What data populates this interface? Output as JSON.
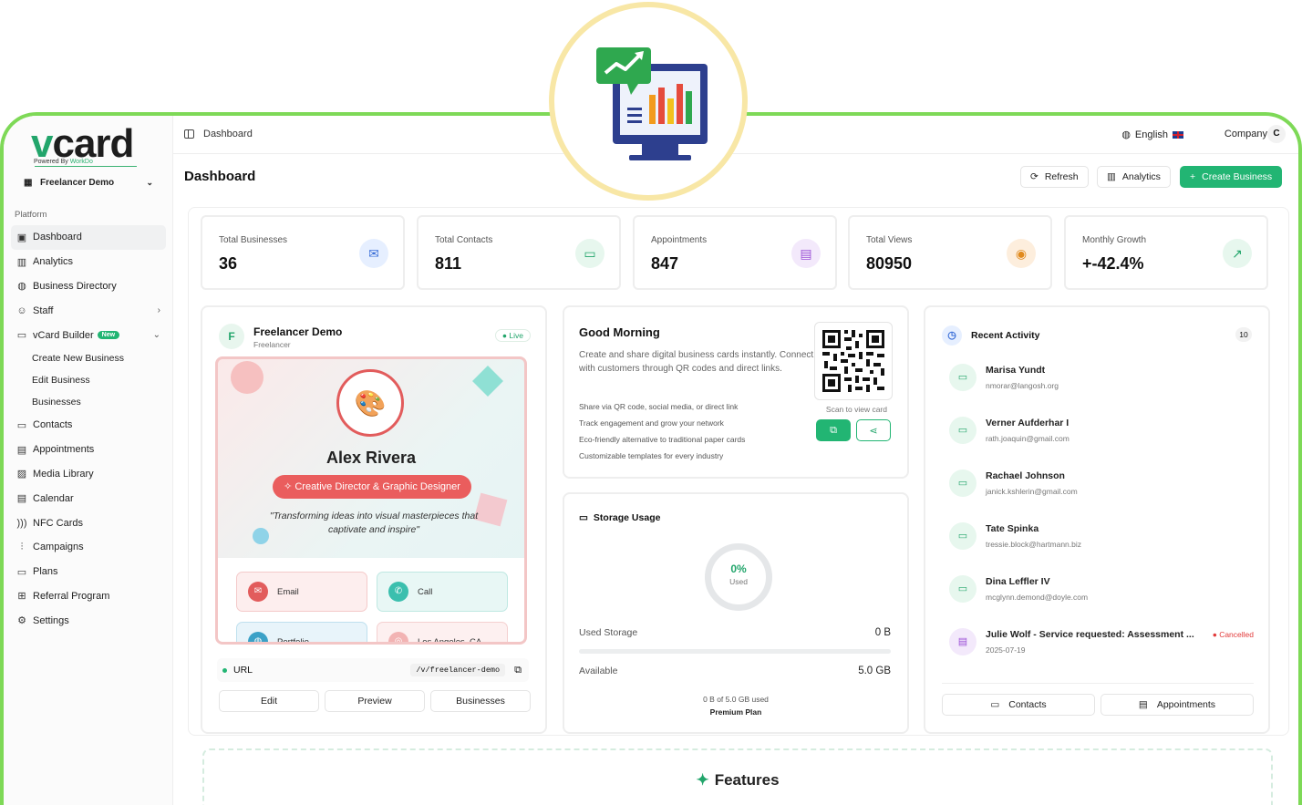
{
  "brand": {
    "logo_v": "v",
    "logo_rest": "card",
    "powered_by_prefix": "Powered By",
    "powered_by_name": "WorkDo"
  },
  "workspace": {
    "name": "Freelancer Demo"
  },
  "sidebar": {
    "heading": "Platform",
    "items": [
      {
        "label": "Dashboard",
        "icon": "grid-icon"
      },
      {
        "label": "Analytics",
        "icon": "bar-chart-icon"
      },
      {
        "label": "Business Directory",
        "icon": "globe-icon"
      },
      {
        "label": "Staff",
        "icon": "users-icon"
      },
      {
        "label": "vCard Builder",
        "icon": "message-square-icon",
        "badge": "New"
      },
      {
        "label": "Create New Business"
      },
      {
        "label": "Edit Business"
      },
      {
        "label": "Businesses"
      },
      {
        "label": "Contacts",
        "icon": "chat-icon"
      },
      {
        "label": "Appointments",
        "icon": "calendar-icon"
      },
      {
        "label": "Media Library",
        "icon": "image-icon"
      },
      {
        "label": "Calendar",
        "icon": "calendar-icon"
      },
      {
        "label": "NFC Cards",
        "icon": "nfc-icon"
      },
      {
        "label": "Campaigns",
        "icon": "signal-icon"
      },
      {
        "label": "Plans",
        "icon": "card-icon"
      },
      {
        "label": "Referral Program",
        "icon": "gift-icon"
      },
      {
        "label": "Settings",
        "icon": "gear-icon"
      }
    ]
  },
  "topbar": {
    "breadcrumb": "Dashboard",
    "language": "English",
    "company": "Company",
    "avatar_initial": "C"
  },
  "header": {
    "title": "Dashboard",
    "refresh": "Refresh",
    "analytics": "Analytics",
    "create": "Create Business"
  },
  "stats": [
    {
      "label": "Total Businesses",
      "value": "36",
      "icon": "mail-icon",
      "color": "#3b6fd8",
      "bg": "#e6efff"
    },
    {
      "label": "Total Contacts",
      "value": "811",
      "icon": "chat-icon",
      "color": "#22a56b",
      "bg": "#e7f7ee"
    },
    {
      "label": "Appointments",
      "value": "847",
      "icon": "calendar-icon",
      "color": "#9b4fd6",
      "bg": "#f3e9fb"
    },
    {
      "label": "Total Views",
      "value": "80950",
      "icon": "eye-icon",
      "color": "#e08a1e",
      "bg": "#fdeedd"
    },
    {
      "label": "Monthly Growth",
      "value": "+-42.4%",
      "icon": "trending-up-icon",
      "color": "#22a56b",
      "bg": "#e7f7ee"
    }
  ],
  "profile": {
    "initial": "F",
    "name": "Freelancer Demo",
    "role": "Freelancer",
    "status": "Live",
    "preview_name": "Alex Rivera",
    "preview_role": "Creative Director & Graphic Designer",
    "preview_quote": "\"Transforming ideas into visual masterpieces that captivate and inspire\"",
    "actions": [
      "Email",
      "Call",
      "Portfolio",
      "Los Angeles, CA"
    ],
    "url_label": "URL",
    "url_path": "/v/freelancer-demo",
    "buttons": [
      "Edit",
      "Preview",
      "Businesses"
    ]
  },
  "greeting": {
    "title": "Good Morning",
    "description": "Create and share digital business cards instantly. Connect with customers through QR codes and direct links.",
    "bullets": [
      "Share via QR code, social media, or direct link",
      "Track engagement and grow your network",
      "Eco-friendly alternative to traditional paper cards",
      "Customizable templates for every industry"
    ],
    "scan": "Scan to view card"
  },
  "storage": {
    "title": "Storage Usage",
    "percent": "0%",
    "used_label": "Used",
    "used_storage_label": "Used Storage",
    "used_storage_value": "0 B",
    "usage_fraction": 0,
    "available_label": "Available",
    "available_value": "5.0 GB",
    "summary": "0 B of 5.0 GB used",
    "plan": "Premium Plan"
  },
  "activity": {
    "title": "Recent Activity",
    "count": "10",
    "items": [
      {
        "name": "Marisa Yundt",
        "detail": "nmorar@langosh.org",
        "icon": "chat-icon"
      },
      {
        "name": "Verner Aufderhar I",
        "detail": "rath.joaquin@gmail.com",
        "icon": "chat-icon"
      },
      {
        "name": "Rachael Johnson",
        "detail": "janick.kshlerin@gmail.com",
        "icon": "chat-icon"
      },
      {
        "name": "Tate Spinka",
        "detail": "tressie.block@hartmann.biz",
        "icon": "chat-icon"
      },
      {
        "name": "Dina Leffler IV",
        "detail": "mcglynn.demond@doyle.com",
        "icon": "chat-icon"
      },
      {
        "name": "Julie Wolf - Service requested: Assessment ...",
        "detail": "2025-07-19",
        "icon": "calendar-icon",
        "status": "Cancelled"
      }
    ],
    "buttons": [
      "Contacts",
      "Appointments"
    ]
  },
  "features": {
    "title": "Features"
  },
  "colors": {
    "brand_green": "#22b573",
    "frame_green": "#7ed957",
    "hero_ring": "#f8e7a6"
  }
}
